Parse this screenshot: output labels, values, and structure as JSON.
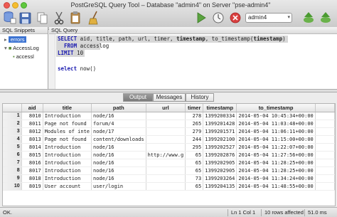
{
  "window": {
    "title": "PostGreSQL Query Tool – Database \"admin4\" on Server \"pse-admin4\""
  },
  "toolbar": {
    "database_select": "admin4",
    "icons": [
      "database-icon",
      "save-icon",
      "copy-icon",
      "cut-icon",
      "paste-icon",
      "broom-icon",
      "execute-icon",
      "explain-icon",
      "cancel-icon",
      "next-icon",
      "transaction-icon"
    ]
  },
  "snippets": {
    "header": "SQL Snippets",
    "items": [
      "errors",
      "AccessLog",
      "accessl"
    ]
  },
  "editor": {
    "header": "SQL Query",
    "lines": [
      {
        "kw": "SELECT",
        "plain": " aid, title, path, url, timer, ",
        "bold": "timestamp",
        "rest": ", to_timestamp(",
        "bold2": "timestamp",
        "end": ")"
      },
      {
        "indent": "  ",
        "kw": "FROM",
        "plain": " accesslog"
      },
      {
        "kw": "LIMIT",
        "plain": " 10"
      },
      {
        "kw": "select",
        "plain": " now()"
      }
    ]
  },
  "result_tabs": [
    "Output",
    "Messages",
    "History"
  ],
  "result": {
    "columns": [
      "aid",
      "title",
      "path",
      "url",
      "timer",
      "timestamp",
      "to_timestamp"
    ],
    "rows": [
      [
        "1",
        "8010",
        "Introduction",
        "node/16",
        "",
        "278",
        "1399200334",
        "2014-05-04 10:45:34+00:00"
      ],
      [
        "2",
        "8011",
        "Page not found",
        "forum/4",
        "",
        "265",
        "1399201428",
        "2014-05-04 11:03:48+00:00"
      ],
      [
        "3",
        "8012",
        "Modules of inte",
        "node/17",
        "",
        "279",
        "1399201571",
        "2014-05-04 11:06:11+00:00"
      ],
      [
        "4",
        "8013",
        "Page not found",
        "content/downloads",
        "",
        "244",
        "1399202100",
        "2014-05-04 11:15:00+00:00"
      ],
      [
        "5",
        "8014",
        "Introduction",
        "node/16",
        "",
        "295",
        "1399202527",
        "2014-05-04 11:22:07+00:00"
      ],
      [
        "6",
        "8015",
        "Introduction",
        "node/16",
        "http://www.g",
        "65",
        "1399202876",
        "2014-05-04 11:27:56+00:00"
      ],
      [
        "7",
        "8016",
        "Introduction",
        "node/16",
        "",
        "65",
        "1399202905",
        "2014-05-04 11:28:25+00:00"
      ],
      [
        "8",
        "8017",
        "Introduction",
        "node/16",
        "",
        "65",
        "1399202905",
        "2014-05-04 11:28:25+00:00"
      ],
      [
        "9",
        "8018",
        "Introduction",
        "node/16",
        "",
        "73",
        "1399203264",
        "2014-05-04 11:34:24+00:00"
      ],
      [
        "10",
        "8019",
        "User account",
        "user/login",
        "",
        "65",
        "1399204135",
        "2014-05-04 11:48:55+00:00"
      ]
    ]
  },
  "status": {
    "left": "OK.",
    "position": "Ln 1 Col 1",
    "rows": "10 rows affected",
    "time": "51.0 ms"
  },
  "colors": {
    "selection": "#3d74d2",
    "keyword": "#1a1ab0"
  }
}
